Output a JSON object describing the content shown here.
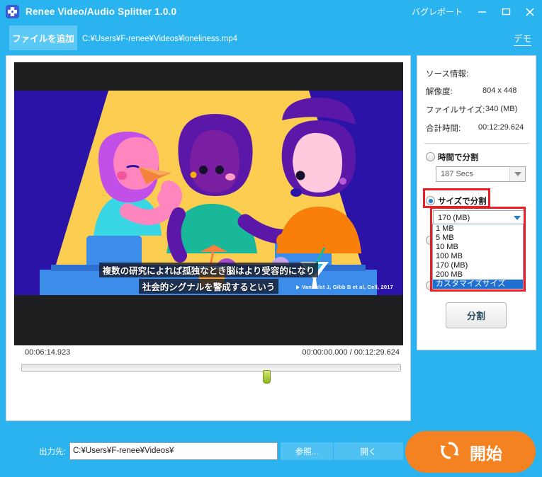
{
  "window": {
    "title": "Renee Video/Audio Splitter 1.0.0",
    "app_icon": "film-reel-icon",
    "bug_report": "バグレポート",
    "minimize": "minimize-icon",
    "maximize": "maximize-icon",
    "close": "close-icon",
    "accent_color": "#29B4F0"
  },
  "file_row": {
    "add_file_label": "ファイルを追加",
    "file_path": "C:¥Users¥F-renee¥Videos¥loneliness.mp4",
    "demo_label": "デモ"
  },
  "preview": {
    "caption_line1": "複数の研究によれば孤独なとき脳はより受容的になり",
    "caption_line2": "社会的シグナルを警成するという",
    "citation": "Vanhalst J, Gibb B et al, Cell, 2017"
  },
  "transport": {
    "current_time": "00:06:14.923",
    "position_total": "00:00:00.000 / 00:12:29.624",
    "play_icon": "play-icon",
    "stop_icon": "stop-icon",
    "volume_icon": "volume-icon"
  },
  "source_info": {
    "heading": "ソース情報:",
    "rows": [
      {
        "label": "解像度:",
        "value": "804 x 448"
      },
      {
        "label": "ファイルサイズ:",
        "value": "340 (MB)"
      },
      {
        "label": "合計時間:",
        "value": "00:12:29.624"
      }
    ]
  },
  "split_options": {
    "by_time": {
      "label": "時間で分割",
      "checked": false,
      "value": "187 Secs"
    },
    "by_size": {
      "label": "サイズで分割",
      "checked": true,
      "value": "170 (MB)"
    },
    "size_options": [
      "1 MB",
      "5 MB",
      "10 MB",
      "100 MB",
      "170 (MB)",
      "200 MB",
      "カスタマイズサイズ"
    ],
    "selected_option": "カスタマイズサイズ",
    "split_button": "分割",
    "highlight_color": "#ee1c23"
  },
  "output": {
    "label": "出力先:",
    "path": "C:¥Users¥F-renee¥Videos¥",
    "browse_label": "参照...",
    "open_label": "開く",
    "start_label": "開始",
    "start_icon": "refresh-icon",
    "start_color": "#F58220"
  }
}
